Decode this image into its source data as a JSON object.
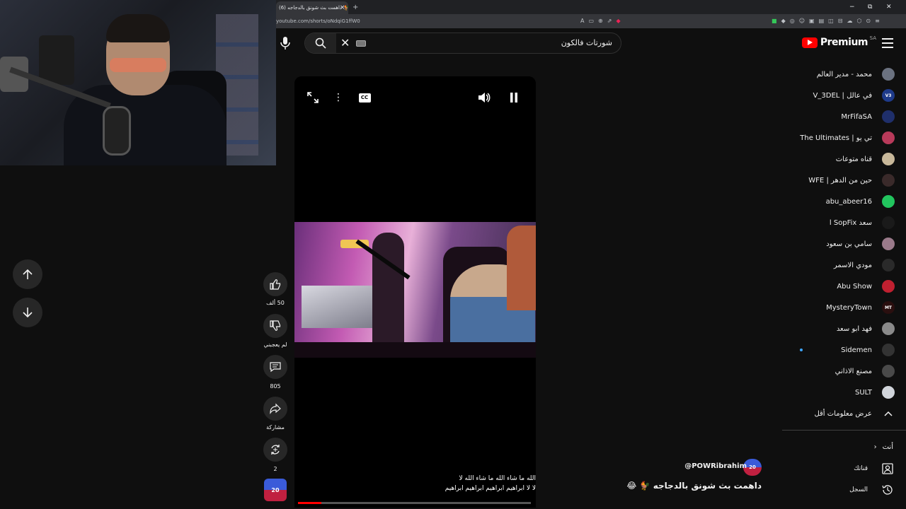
{
  "browser": {
    "tab_title": "(6) داهمت بث شونق بالدجاجه 🐓",
    "tab_close": "×",
    "new_tab": "+",
    "url": "youtube.com/shorts/oNdqiG1ffW0",
    "window_minimize": "−",
    "window_restore": "⧉",
    "window_close": "✕"
  },
  "header": {
    "search_value": "شورتات فالكون",
    "logo_text": "Premium",
    "logo_region": "SA"
  },
  "player": {
    "subtitle_line1": "الله ما شاء الله ما شاء الله لا",
    "subtitle_line2": "لا لا ابراهيم ابراهيم ابراهيم ابراهيم",
    "progress": 0.1
  },
  "actions": {
    "likes": "50 ألف",
    "dislike_label": "لم يعجبني",
    "comments": "805",
    "share_label": "مشاركة",
    "remix_count": "2",
    "avatar_badge": "20"
  },
  "channel": {
    "handle": "@POWRibrahim",
    "avatar_badge": "20",
    "title": "داهمت بث شونق بالدجاجه 🐓 😂"
  },
  "sidebar": {
    "items": [
      {
        "label": "محمد - مدير العالم",
        "color": "#6b7280",
        "badge": ""
      },
      {
        "label": "في عالل | V_3DEL",
        "color": "#1e3a8a",
        "badge": "V3"
      },
      {
        "label": "MrFifaSA",
        "color": "#1f2f6b",
        "badge": ""
      },
      {
        "label": "تي يو | The Ultimates",
        "color": "#b83a5a",
        "badge": ""
      },
      {
        "label": "قناه متوعات",
        "color": "#c8b89a",
        "badge": ""
      },
      {
        "label": "حين من الدهر | WFE",
        "color": "#3a2a2a",
        "badge": ""
      },
      {
        "label": "abu_abeer16",
        "color": "#22c55e",
        "badge": ""
      },
      {
        "label": "سعد l SopFix",
        "color": "#1a1a1a",
        "badge": ""
      },
      {
        "label": "سامي بن سعود",
        "color": "#9a7a8a",
        "badge": ""
      },
      {
        "label": "مودي الاسمر",
        "color": "#2a2a2a",
        "badge": ""
      },
      {
        "label": "Abu Show",
        "color": "#c02030",
        "badge": ""
      },
      {
        "label": "MysteryTown",
        "color": "#2a0f0f",
        "badge": "MT"
      },
      {
        "label": "فهد ابو سعد",
        "color": "#8a8a8a",
        "badge": ""
      },
      {
        "label": "Sidemen",
        "color": "#333333",
        "badge": ""
      },
      {
        "label": "مصنع الاذاني",
        "color": "#4a4a4a",
        "badge": ""
      },
      {
        "label": "SULT",
        "color": "#d1d5db",
        "badge": ""
      }
    ],
    "show_less": "عرض معلومات أقل",
    "you_label": "أنت",
    "your_channel": "قناتك",
    "history": "السجل"
  }
}
